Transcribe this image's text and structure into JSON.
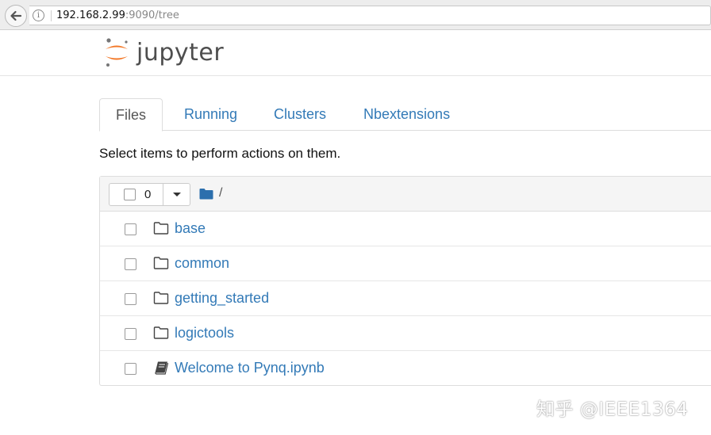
{
  "browser": {
    "url_host": "192.168.2.99",
    "url_rest": ":9090/tree",
    "info_glyph": "i",
    "back_icon": "back-arrow-icon"
  },
  "header": {
    "logo_text": "jupyter",
    "logo_icon": "jupyter-logo-icon",
    "colors": {
      "logo_orange": "#f37726",
      "logo_gray": "#767677"
    }
  },
  "tabs": [
    {
      "label": "Files",
      "active": true
    },
    {
      "label": "Running",
      "active": false
    },
    {
      "label": "Clusters",
      "active": false
    },
    {
      "label": "Nbextensions",
      "active": false
    }
  ],
  "instructions": "Select items to perform actions on them.",
  "list": {
    "selected_count": "0",
    "breadcrumb": "/",
    "items": [
      {
        "name": "base",
        "type": "folder"
      },
      {
        "name": "common",
        "type": "folder"
      },
      {
        "name": "getting_started",
        "type": "folder"
      },
      {
        "name": "logictools",
        "type": "folder"
      },
      {
        "name": "Welcome to Pynq.ipynb",
        "type": "notebook"
      }
    ]
  },
  "watermark": "知乎 @IEEE1364",
  "colors": {
    "link": "#337ab7",
    "folder_blue": "#2c6fad"
  }
}
